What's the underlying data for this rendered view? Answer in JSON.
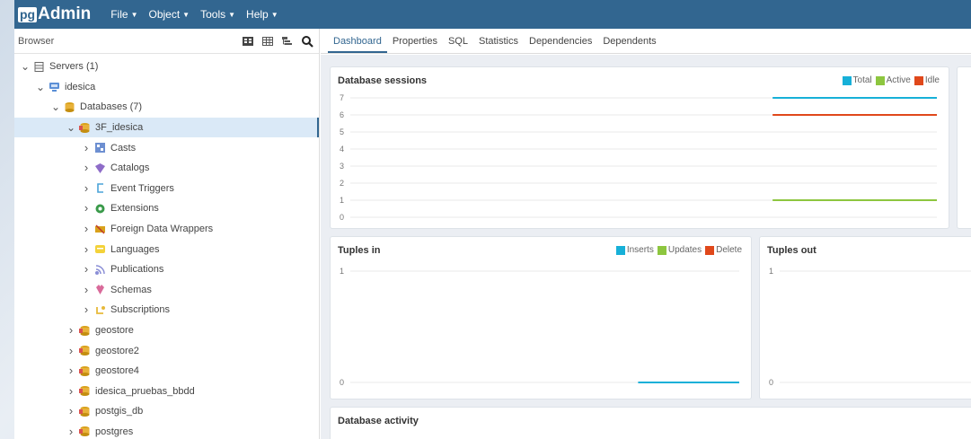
{
  "app": {
    "brand_pg": "pg",
    "brand_name": "Admin"
  },
  "menu": [
    {
      "label": "File"
    },
    {
      "label": "Object"
    },
    {
      "label": "Tools"
    },
    {
      "label": "Help"
    }
  ],
  "browser": {
    "title": "Browser",
    "tree": [
      {
        "label": "Servers (1)",
        "level": 0,
        "state": "open",
        "icon": "servers-icon"
      },
      {
        "label": "idesica",
        "level": 1,
        "state": "open",
        "icon": "server-icon"
      },
      {
        "label": "Databases (7)",
        "level": 2,
        "state": "open",
        "icon": "databases-icon"
      },
      {
        "label": "3F_idesica",
        "level": 3,
        "state": "open",
        "icon": "database-icon",
        "selected": true
      },
      {
        "label": "Casts",
        "level": 4,
        "state": "closed",
        "icon": "casts-icon"
      },
      {
        "label": "Catalogs",
        "level": 4,
        "state": "closed",
        "icon": "catalogs-icon"
      },
      {
        "label": "Event Triggers",
        "level": 4,
        "state": "closed",
        "icon": "event-triggers-icon"
      },
      {
        "label": "Extensions",
        "level": 4,
        "state": "closed",
        "icon": "extensions-icon"
      },
      {
        "label": "Foreign Data Wrappers",
        "level": 4,
        "state": "closed",
        "icon": "foreign-data-wrappers-icon"
      },
      {
        "label": "Languages",
        "level": 4,
        "state": "closed",
        "icon": "languages-icon"
      },
      {
        "label": "Publications",
        "level": 4,
        "state": "closed",
        "icon": "publications-icon"
      },
      {
        "label": "Schemas",
        "level": 4,
        "state": "closed",
        "icon": "schemas-icon"
      },
      {
        "label": "Subscriptions",
        "level": 4,
        "state": "closed",
        "icon": "subscriptions-icon"
      },
      {
        "label": "geostore",
        "level": 3,
        "state": "closed",
        "icon": "database-icon"
      },
      {
        "label": "geostore2",
        "level": 3,
        "state": "closed",
        "icon": "database-icon"
      },
      {
        "label": "geostore4",
        "level": 3,
        "state": "closed",
        "icon": "database-icon"
      },
      {
        "label": "idesica_pruebas_bbdd",
        "level": 3,
        "state": "closed",
        "icon": "database-icon"
      },
      {
        "label": "postgis_db",
        "level": 3,
        "state": "closed",
        "icon": "database-icon"
      },
      {
        "label": "postgres",
        "level": 3,
        "state": "closed",
        "icon": "database-icon"
      }
    ]
  },
  "tabs": [
    {
      "label": "Dashboard",
      "active": true
    },
    {
      "label": "Properties"
    },
    {
      "label": "SQL"
    },
    {
      "label": "Statistics"
    },
    {
      "label": "Dependencies"
    },
    {
      "label": "Dependents"
    }
  ],
  "colors": {
    "navbar": "#326690",
    "series_blue": "#17b0d8",
    "series_green": "#8dc63f",
    "series_red": "#e0481b"
  },
  "chart_data": [
    {
      "type": "line",
      "title": "Database sessions",
      "legend": [
        "Total",
        "Active",
        "Idle"
      ],
      "legend_placement": "top-right",
      "ylim": [
        0,
        7
      ],
      "y_ticks": [
        "7",
        "6",
        "5",
        "4",
        "3",
        "2",
        "1",
        "0"
      ],
      "series": [
        {
          "name": "Total",
          "color": "#17b0d8",
          "y": [
            7,
            7
          ]
        },
        {
          "name": "Active",
          "color": "#8dc63f",
          "y": [
            1,
            1
          ]
        },
        {
          "name": "Idle",
          "color": "#e0481b",
          "y": [
            6,
            6
          ]
        }
      ]
    },
    {
      "type": "line",
      "title": "Tuples in",
      "legend": [
        "Inserts",
        "Updates",
        "Delete"
      ],
      "legend_placement": "top-right",
      "ylim": [
        0,
        1
      ],
      "y_ticks": [
        "1",
        "0"
      ],
      "series": [
        {
          "name": "Inserts",
          "color": "#17b0d8",
          "y": [
            0,
            0
          ]
        }
      ]
    },
    {
      "type": "line",
      "title": "Tuples out",
      "ylim": [
        0,
        1
      ],
      "y_ticks": [
        "1",
        "0"
      ],
      "series": []
    }
  ],
  "activity": {
    "title": "Database activity"
  }
}
